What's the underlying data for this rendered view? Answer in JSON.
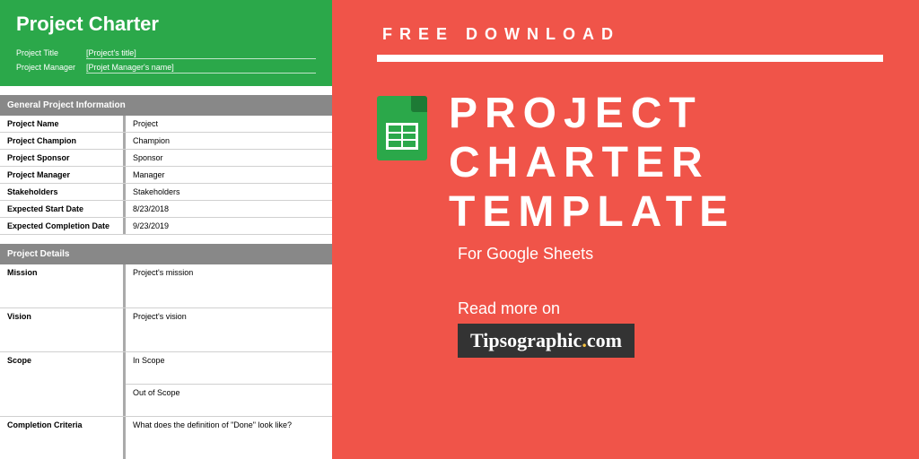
{
  "sheet": {
    "title": "Project Charter",
    "project_title_label": "Project Title",
    "project_title_value": "[Project's title]",
    "project_manager_label": "Project Manager",
    "project_manager_value": "[Projet Manager's name]",
    "section_info": "General Project Information",
    "rows": [
      {
        "label": "Project Name",
        "value": "Project"
      },
      {
        "label": "Project Champion",
        "value": "Champion"
      },
      {
        "label": "Project Sponsor",
        "value": "Sponsor"
      },
      {
        "label": "Project Manager",
        "value": "Manager"
      },
      {
        "label": "Stakeholders",
        "value": "Stakeholders"
      },
      {
        "label": "Expected Start Date",
        "value": "8/23/2018"
      },
      {
        "label": "Expected Completion Date",
        "value": "9/23/2019"
      }
    ],
    "section_details": "Project Details",
    "mission_label": "Mission",
    "mission_value": "Project's mission",
    "vision_label": "Vision",
    "vision_value": "Project's vision",
    "scope_label": "Scope",
    "scope_in": "In Scope",
    "scope_out": "Out of Scope",
    "completion_label": "Completion Criteria",
    "completion_value": "What does the definition of \"Done\" look like?"
  },
  "promo": {
    "kicker": "FREE DOWNLOAD",
    "line1": "PROJECT",
    "line2": "CHARTER",
    "line3": "TEMPLATE",
    "subtitle": "For Google Sheets",
    "readmore": "Read more on",
    "brand_main": "Tipsographic",
    "brand_dot": "．",
    "brand_tld": "com"
  }
}
